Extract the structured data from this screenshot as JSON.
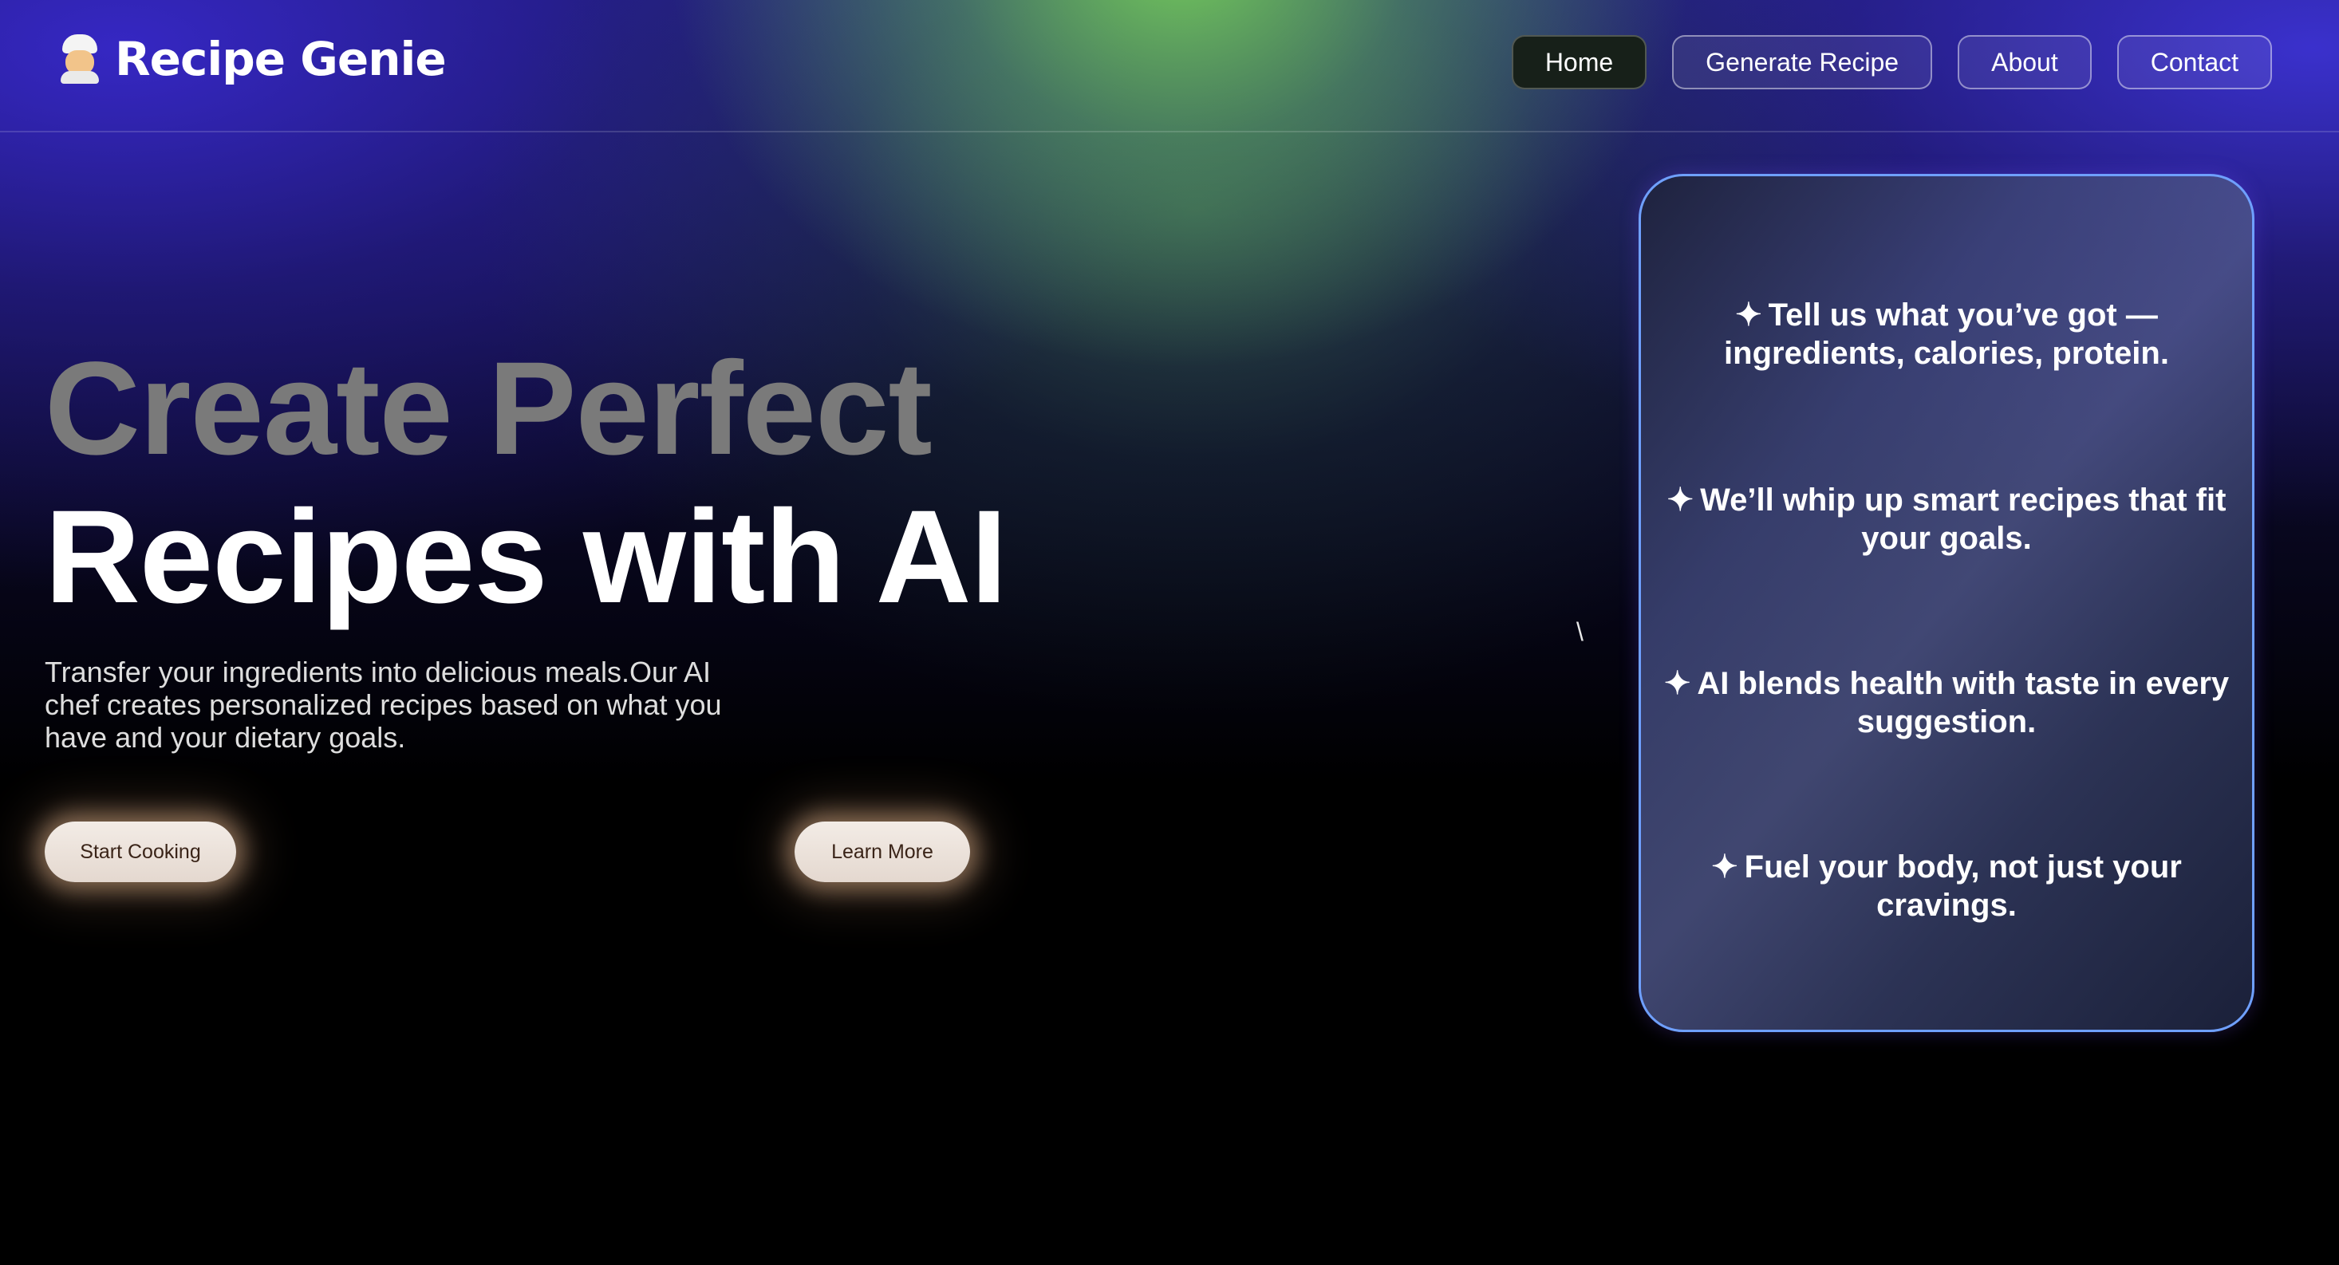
{
  "header": {
    "brand_name": "Recipe Genie",
    "brand_icon": "chef-icon",
    "nav": [
      {
        "label": "Home",
        "active": true
      },
      {
        "label": "Generate Recipe",
        "active": false
      },
      {
        "label": "About",
        "active": false
      },
      {
        "label": "Contact",
        "active": false
      }
    ]
  },
  "hero": {
    "title_line1": "Create Perfect",
    "title_line2": "Recipes with AI",
    "description": "Transfer your ingredients into delicious meals.Our AI chef creates personalized recipes based on what you have and your dietary goals.",
    "primary_button": "Start Cooking",
    "secondary_button": "Learn More",
    "stray_character": "\\"
  },
  "features": {
    "star_glyph": "✦",
    "items": [
      "Tell us what you’ve got — ingredients, calories, protein.",
      "We’ll whip up smart recipes that fit your goals.",
      "AI blends health with taste in every suggestion.",
      "Fuel your body, not just your cravings."
    ]
  },
  "colors": {
    "accent_blue": "#6fa0ff",
    "active_nav_bg": "#172019",
    "button_bg": "#f3ece6",
    "button_text": "#3a2418",
    "muted_title": "#7a7a7a"
  }
}
